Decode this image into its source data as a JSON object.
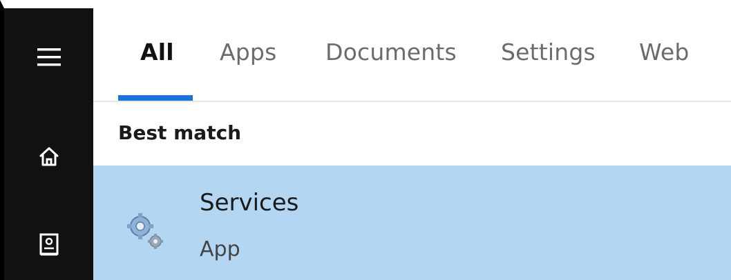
{
  "nav": {
    "menu_icon": "hamburger-menu-icon",
    "home_icon": "home-icon",
    "notebook_icon": "notebook-icon"
  },
  "tabs": [
    {
      "label": "All",
      "active": true
    },
    {
      "label": "Apps",
      "active": false
    },
    {
      "label": "Documents",
      "active": false
    },
    {
      "label": "Settings",
      "active": false
    },
    {
      "label": "Web",
      "active": false
    }
  ],
  "section": {
    "label": "Best match"
  },
  "result": {
    "title": "Services",
    "subtitle": "App",
    "icon": "services-gear-icon"
  },
  "colors": {
    "rail": "#111111",
    "accent": "#1a73d9",
    "selected_row": "#b3d6f2"
  }
}
